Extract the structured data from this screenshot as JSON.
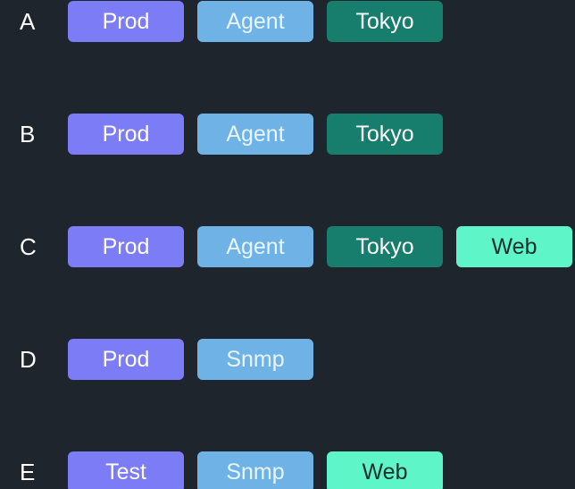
{
  "rows": [
    {
      "label": "A",
      "tags": [
        "Prod",
        "Agent",
        "Tokyo"
      ]
    },
    {
      "label": "B",
      "tags": [
        "Prod",
        "Agent",
        "Tokyo"
      ]
    },
    {
      "label": "C",
      "tags": [
        "Prod",
        "Agent",
        "Tokyo",
        "Web"
      ]
    },
    {
      "label": "D",
      "tags": [
        "Prod",
        "Snmp"
      ]
    },
    {
      "label": "E",
      "tags": [
        "Test",
        "Snmp",
        "Web"
      ]
    }
  ],
  "colors": {
    "background": "#1f252d",
    "prod": "#7b7cf6",
    "test": "#7b7cf6",
    "agent": "#6fb3e6",
    "snmp": "#6fb3e6",
    "tokyo": "#177d6c",
    "web": "#5ef5c9"
  }
}
